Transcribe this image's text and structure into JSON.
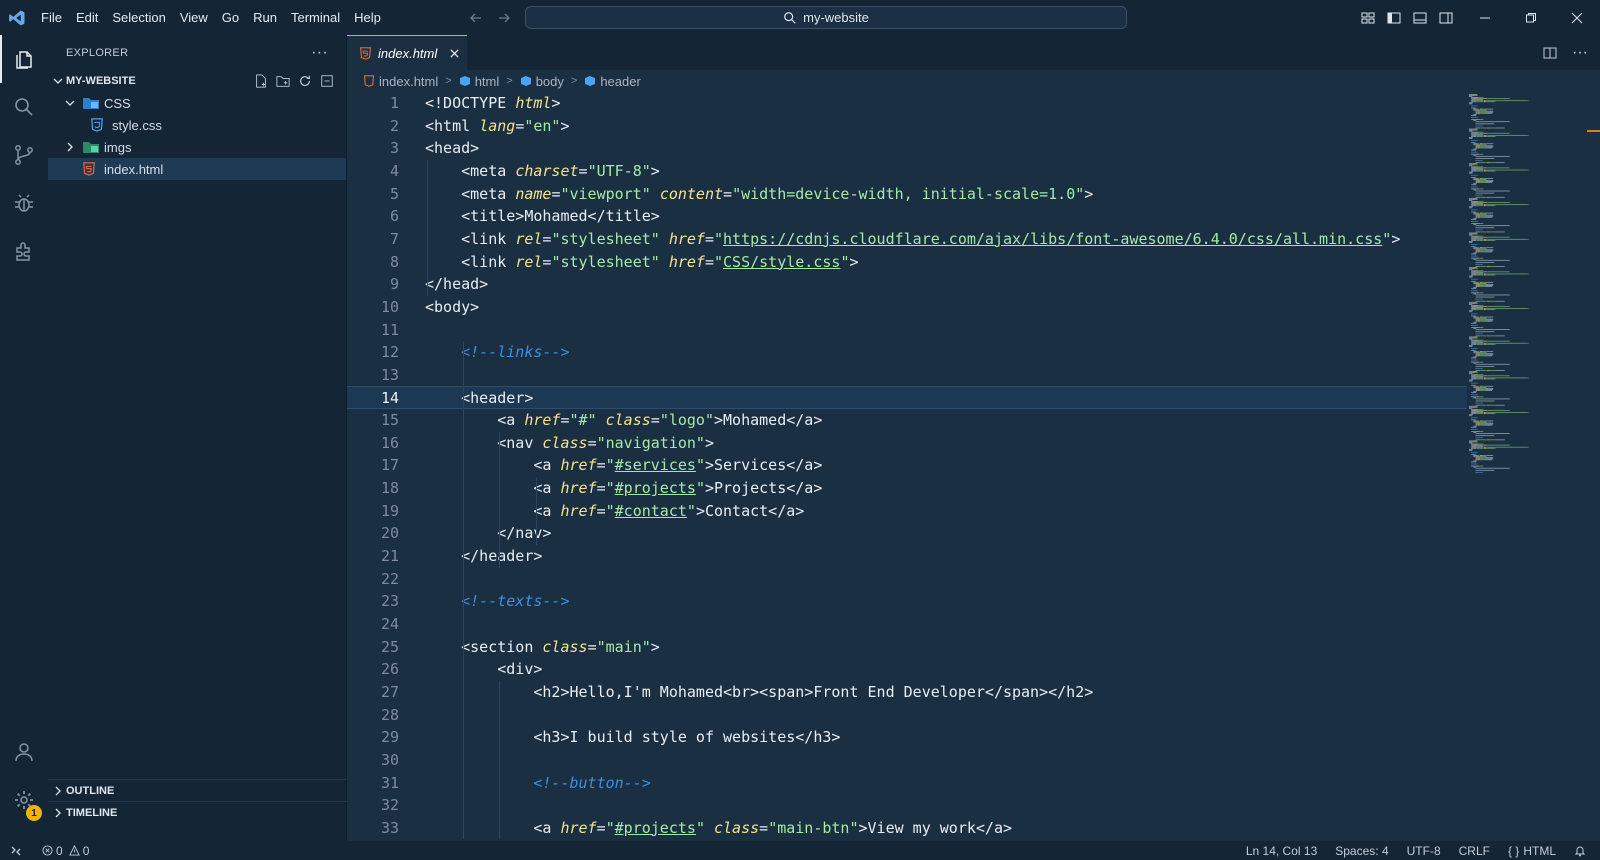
{
  "titlebar": {
    "menu": [
      "File",
      "Edit",
      "Selection",
      "View",
      "Go",
      "Run",
      "Terminal",
      "Help"
    ],
    "search_text": "my-website"
  },
  "sidebar": {
    "title": "EXPLORER",
    "workspace": "MY-WEBSITE",
    "tree": [
      {
        "label": "CSS",
        "type": "folder",
        "expanded": true
      },
      {
        "label": "style.css",
        "type": "css-file"
      },
      {
        "label": "imgs",
        "type": "folder",
        "expanded": false
      },
      {
        "label": "index.html",
        "type": "html-file",
        "selected": true
      }
    ],
    "outline": "OUTLINE",
    "timeline": "TIMELINE"
  },
  "activity_badge": "1",
  "editor": {
    "tab_label": "index.html",
    "breadcrumb": [
      "index.html",
      "html",
      "body",
      "header"
    ],
    "current_line": 14,
    "lines": [
      {
        "n": "1",
        "parts": [
          [
            "t",
            "<!DOCTYPE "
          ],
          [
            "a",
            "html"
          ],
          [
            "t",
            ">"
          ]
        ]
      },
      {
        "n": "2",
        "parts": [
          [
            "t",
            "<html "
          ],
          [
            "a",
            "lang"
          ],
          [
            "t",
            "="
          ],
          [
            "v",
            "\"en\""
          ],
          [
            "t",
            ">"
          ]
        ]
      },
      {
        "n": "3",
        "parts": [
          [
            "t",
            "<head>"
          ]
        ]
      },
      {
        "n": "4",
        "parts": [
          [
            "t",
            "    <meta "
          ],
          [
            "a",
            "charset"
          ],
          [
            "t",
            "="
          ],
          [
            "v",
            "\"UTF-8\""
          ],
          [
            "t",
            ">"
          ]
        ]
      },
      {
        "n": "5",
        "parts": [
          [
            "t",
            "    <meta "
          ],
          [
            "a",
            "name"
          ],
          [
            "t",
            "="
          ],
          [
            "v",
            "\"viewport\""
          ],
          [
            "t",
            " "
          ],
          [
            "a",
            "content"
          ],
          [
            "t",
            "="
          ],
          [
            "v",
            "\"width=device-width, initial-scale=1.0\""
          ],
          [
            "t",
            ">"
          ]
        ]
      },
      {
        "n": "6",
        "parts": [
          [
            "t",
            "    <title>Mohamed</title>"
          ]
        ]
      },
      {
        "n": "7",
        "parts": [
          [
            "t",
            "    <link "
          ],
          [
            "a",
            "rel"
          ],
          [
            "t",
            "="
          ],
          [
            "v",
            "\"stylesheet\""
          ],
          [
            "t",
            " "
          ],
          [
            "a",
            "href"
          ],
          [
            "t",
            "="
          ],
          [
            "v",
            "\""
          ],
          [
            "u",
            "https://cdnjs.cloudflare.com/ajax/libs/font-awesome/6.4.0/css/all.min.css"
          ],
          [
            "v",
            "\""
          ],
          [
            "t",
            ">"
          ]
        ]
      },
      {
        "n": "8",
        "parts": [
          [
            "t",
            "    <link "
          ],
          [
            "a",
            "rel"
          ],
          [
            "t",
            "="
          ],
          [
            "v",
            "\"stylesheet\""
          ],
          [
            "t",
            " "
          ],
          [
            "a",
            "href"
          ],
          [
            "t",
            "="
          ],
          [
            "v",
            "\""
          ],
          [
            "u",
            "CSS/style.css"
          ],
          [
            "v",
            "\""
          ],
          [
            "t",
            ">"
          ]
        ]
      },
      {
        "n": "9",
        "parts": [
          [
            "t",
            "</head>"
          ]
        ]
      },
      {
        "n": "10",
        "parts": [
          [
            "t",
            "<body>"
          ]
        ]
      },
      {
        "n": "11",
        "parts": []
      },
      {
        "n": "12",
        "parts": [
          [
            "t",
            "    "
          ],
          [
            "c",
            "<!--links-->"
          ]
        ]
      },
      {
        "n": "13",
        "parts": []
      },
      {
        "n": "14",
        "parts": [
          [
            "t",
            "    <header>"
          ]
        ]
      },
      {
        "n": "15",
        "parts": [
          [
            "t",
            "        <a "
          ],
          [
            "a",
            "href"
          ],
          [
            "t",
            "="
          ],
          [
            "v",
            "\"#\""
          ],
          [
            "t",
            " "
          ],
          [
            "a",
            "class"
          ],
          [
            "t",
            "="
          ],
          [
            "v",
            "\"logo\""
          ],
          [
            "t",
            ">Mohamed</a>"
          ]
        ]
      },
      {
        "n": "16",
        "parts": [
          [
            "t",
            "        <nav "
          ],
          [
            "a",
            "class"
          ],
          [
            "t",
            "="
          ],
          [
            "v",
            "\"navigation\""
          ],
          [
            "t",
            ">"
          ]
        ]
      },
      {
        "n": "17",
        "parts": [
          [
            "t",
            "            <a "
          ],
          [
            "a",
            "href"
          ],
          [
            "t",
            "="
          ],
          [
            "v",
            "\""
          ],
          [
            "u",
            "#services"
          ],
          [
            "v",
            "\""
          ],
          [
            "t",
            ">Services</a>"
          ]
        ]
      },
      {
        "n": "18",
        "parts": [
          [
            "t",
            "            <a "
          ],
          [
            "a",
            "href"
          ],
          [
            "t",
            "="
          ],
          [
            "v",
            "\""
          ],
          [
            "u",
            "#projects"
          ],
          [
            "v",
            "\""
          ],
          [
            "t",
            ">Projects</a>"
          ]
        ]
      },
      {
        "n": "19",
        "parts": [
          [
            "t",
            "            <a "
          ],
          [
            "a",
            "href"
          ],
          [
            "t",
            "="
          ],
          [
            "v",
            "\""
          ],
          [
            "u",
            "#contact"
          ],
          [
            "v",
            "\""
          ],
          [
            "t",
            ">Contact</a>"
          ]
        ]
      },
      {
        "n": "20",
        "parts": [
          [
            "t",
            "        </nav>"
          ]
        ]
      },
      {
        "n": "21",
        "parts": [
          [
            "t",
            "    </header>"
          ]
        ]
      },
      {
        "n": "22",
        "parts": []
      },
      {
        "n": "23",
        "parts": [
          [
            "t",
            "    "
          ],
          [
            "c",
            "<!--texts-->"
          ]
        ]
      },
      {
        "n": "24",
        "parts": []
      },
      {
        "n": "25",
        "parts": [
          [
            "t",
            "    <section "
          ],
          [
            "a",
            "class"
          ],
          [
            "t",
            "="
          ],
          [
            "v",
            "\"main\""
          ],
          [
            "t",
            ">"
          ]
        ]
      },
      {
        "n": "26",
        "parts": [
          [
            "t",
            "        <div>"
          ]
        ]
      },
      {
        "n": "27",
        "parts": [
          [
            "t",
            "            <h2>Hello,I'm Mohamed<br><span>Front End Developer</span></h2>"
          ]
        ]
      },
      {
        "n": "28",
        "parts": []
      },
      {
        "n": "29",
        "parts": [
          [
            "t",
            "            <h3>I build style of websites</h3>"
          ]
        ]
      },
      {
        "n": "30",
        "parts": []
      },
      {
        "n": "31",
        "parts": [
          [
            "t",
            "            "
          ],
          [
            "c",
            "<!--button-->"
          ]
        ]
      },
      {
        "n": "32",
        "parts": []
      },
      {
        "n": "33",
        "parts": [
          [
            "t",
            "            <a "
          ],
          [
            "a",
            "href"
          ],
          [
            "t",
            "="
          ],
          [
            "v",
            "\""
          ],
          [
            "u",
            "#projects"
          ],
          [
            "v",
            "\""
          ],
          [
            "t",
            " "
          ],
          [
            "a",
            "class"
          ],
          [
            "t",
            "="
          ],
          [
            "v",
            "\"main-btn\""
          ],
          [
            "t",
            ">View my work</a>"
          ]
        ]
      }
    ]
  },
  "statusbar": {
    "errors": "0",
    "warnings": "0",
    "position": "Ln 14, Col 13",
    "spaces": "Spaces: 4",
    "encoding": "UTF-8",
    "eol": "CRLF",
    "language": "HTML"
  }
}
